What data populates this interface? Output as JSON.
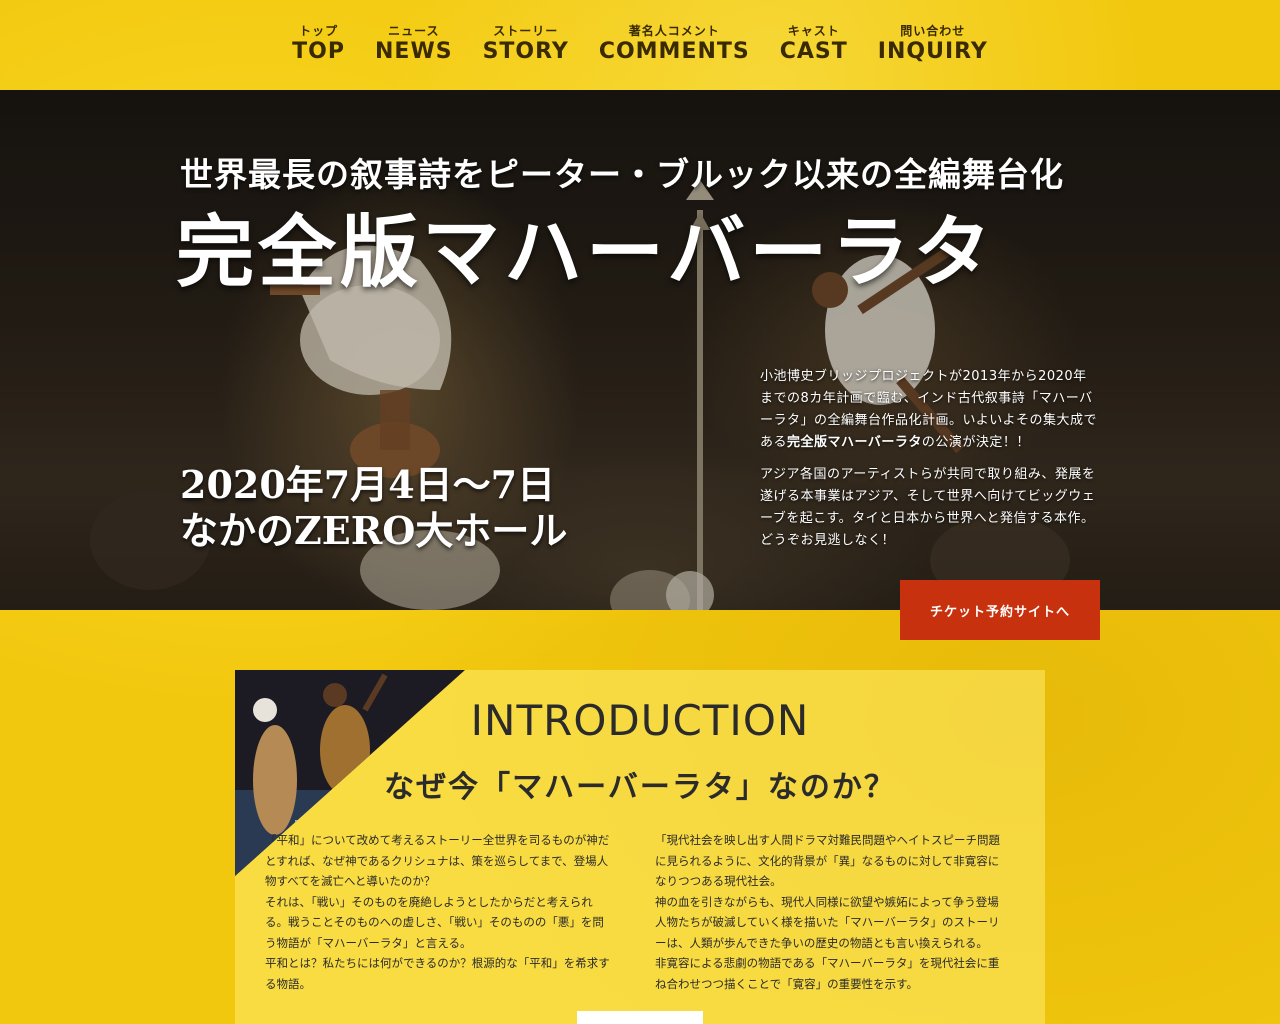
{
  "nav": {
    "items": [
      {
        "ja": "トップ",
        "en": "TOP"
      },
      {
        "ja": "ニュース",
        "en": "NEWS"
      },
      {
        "ja": "ストーリー",
        "en": "STORY"
      },
      {
        "ja": "著名人コメント",
        "en": "COMMENTS"
      },
      {
        "ja": "キャスト",
        "en": "CAST"
      },
      {
        "ja": "問い合わせ",
        "en": "INQUIRY"
      }
    ]
  },
  "hero": {
    "kicker": "世界最長の叙事詩をピーター・ブルック以来の全編舞台化",
    "title": "完全版マハーバーラタ",
    "date_line": "2020年7月4日～7日",
    "venue_line": "なかのZERO大ホール",
    "desc1_pre": "小池博史ブリッジプロジェクトが2013年から2020年までの8カ年計画で臨む、インド古代叙事詩「マハーバーラタ」の全編舞台作品化計画。いよいよその集大成である",
    "desc1_bold": "完全版マハーバーラタ",
    "desc1_post": "の公演が決定！！",
    "desc2": "アジア各国のアーティストらが共同で取り組み、発展を遂げる本事業はアジア、そして世界へ向けてビッグウェーブを起こす。タイと日本から世界へと発信する本作。どうぞお見逃しなく！",
    "ticket_label": "チケット予約サイトへ"
  },
  "intro": {
    "heading": "INTRODUCTION",
    "subheading": "なぜ今「マハーバーラタ」なのか？",
    "left_lines": [
      "「平和」について改めて考えるストーリー全世界を司るものが神だとすれば、なぜ神であるクリシュナは、策を巡らしてまで、登場人物すべてを滅亡へと導いたのか？",
      "それは、「戦い」そのものを廃絶しようとしたからだと考えられる。戦うことそのものへの虚しさ、「戦い」そのものの「悪」を問う物語が「マハーバーラタ」と言える。",
      "平和とは？私たちには何ができるのか？根源的な「平和」を希求する物語。"
    ],
    "right_lines": [
      "「現代社会を映し出す人間ドラマ対難民問題やヘイトスピーチ問題に見られるように、文化的背景が「異」なるものに対して非寛容になりつつある現代社会。",
      "神の血を引きながらも、現代人同様に欲望や嫉妬によって争う登場人物たちが破滅していく様を描いた「マハーバーラタ」のストーリーは、人類が歩んできた争いの歴史の物語とも言い換えられる。",
      "非寛容による悲劇の物語である「マハーバーラタ」を現代社会に重ね合わせつつ描くことで「寛容」の重要性を示す。"
    ]
  },
  "colors": {
    "background": "#f2c80e",
    "nav_text": "#3a2a00",
    "ticket_button": "#c8310d",
    "text_dark": "#2b2b2b"
  }
}
